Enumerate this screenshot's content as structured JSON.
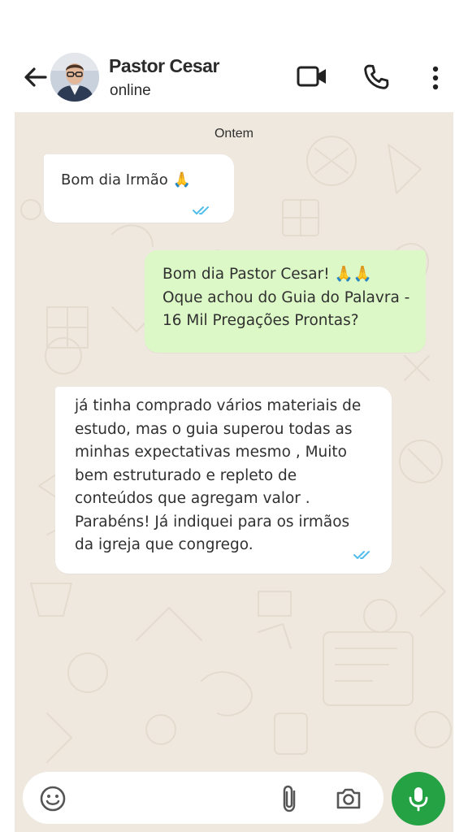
{
  "header": {
    "contact_name": "Pastor Cesar",
    "status": "online"
  },
  "icons": {
    "back": "arrow-left-icon",
    "video": "video-camera-icon",
    "call": "phone-icon",
    "more": "three-dots-vertical-icon",
    "emoji": "emoji-icon",
    "attach": "paperclip-icon",
    "camera": "camera-icon",
    "mic": "microphone-icon"
  },
  "chat": {
    "date_label": "Ontem",
    "messages": [
      {
        "direction": "received",
        "text": "Bom dia Irmão 🙏"
      },
      {
        "direction": "sent",
        "text": "Bom dia Pastor Cesar! 🙏🙏\nOque achou do Guia do Palavra -\n16 Mil Pregações Prontas?"
      },
      {
        "direction": "received",
        "text": "já tinha comprado vários materiais de\nestudo, mas o guia  superou todas as\nminhas expectativas mesmo , Muito\nbem estruturado e repleto de\nconteúdos que agregam valor .\nParabéns! Já indiquei para os irmãos\nda igreja que congrego."
      }
    ]
  },
  "colors": {
    "chat_background": "#efe8df",
    "sent_bubble": "#dcf8c6",
    "received_bubble": "#ffffff",
    "read_ticks": "#53bdeb",
    "mic_button": "#25a244",
    "header_icons": "#222222"
  }
}
